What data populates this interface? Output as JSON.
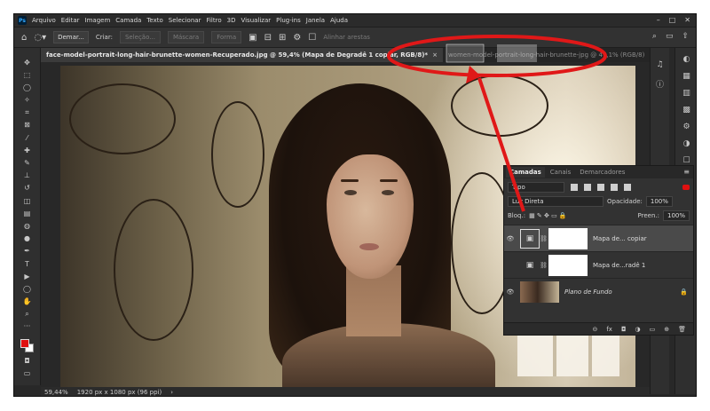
{
  "menubar": {
    "logo": "Ps",
    "items": [
      "Arquivo",
      "Editar",
      "Imagem",
      "Camada",
      "Texto",
      "Selecionar",
      "Filtro",
      "3D",
      "Visualizar",
      "Plug-ins",
      "Janela",
      "Ajuda"
    ],
    "window_controls": [
      "–",
      "□",
      "✕"
    ]
  },
  "optionsbar": {
    "mode_value": "Demar...",
    "create_label": "Criar:",
    "buttons": [
      "Seleção...",
      "Máscara",
      "Forma"
    ],
    "align_edges_label": "Alinhar arestas"
  },
  "tabs": [
    {
      "label": "face-model-portrait-long-hair-brunette-women-Recuperado.jpg @ 59,4% (Mapa de Degradê 1 copiar, RGB/8)",
      "active": true,
      "modified": "*",
      "close": "×"
    },
    {
      "label": "women-model-portrait-long-hair-brunette-jpg @ 47,1% (RGB/8)",
      "active": false,
      "close": "×"
    }
  ],
  "layers_panel": {
    "tabs": [
      "Camadas",
      "Canais",
      "Demarcadores"
    ],
    "kind_value": "Tipo",
    "blend_mode": "Luz Direta",
    "opacity_label": "Opacidade:",
    "opacity_value": "100%",
    "lock_label": "Bloq.:",
    "fill_label": "Preen.:",
    "fill_value": "100%",
    "layers": [
      {
        "name": "Mapa de... copiar",
        "visible": true,
        "selected": true,
        "kind": "adjustment"
      },
      {
        "name": "Mapa de...radê 1",
        "visible": false,
        "selected": false,
        "kind": "adjustment"
      },
      {
        "name": "Plano de Fundo",
        "visible": true,
        "selected": false,
        "kind": "image",
        "locked": true
      }
    ],
    "bottom_icons": [
      "link-icon",
      "fx-icon",
      "mask-icon",
      "adjustment-icon",
      "group-icon",
      "new-layer-icon",
      "trash-icon"
    ],
    "bottom_labels": [
      "⊝",
      "fx",
      "◘",
      "◑",
      "▭",
      "⊕",
      "🗑"
    ]
  },
  "statusbar": {
    "zoom": "59,44%",
    "doc_info": "1920 px x 1080 px (96 ppi)",
    "arrow": "›"
  },
  "colors": {
    "foreground": "#e01010",
    "background": "#ffffff",
    "annotation": "#e01818"
  }
}
